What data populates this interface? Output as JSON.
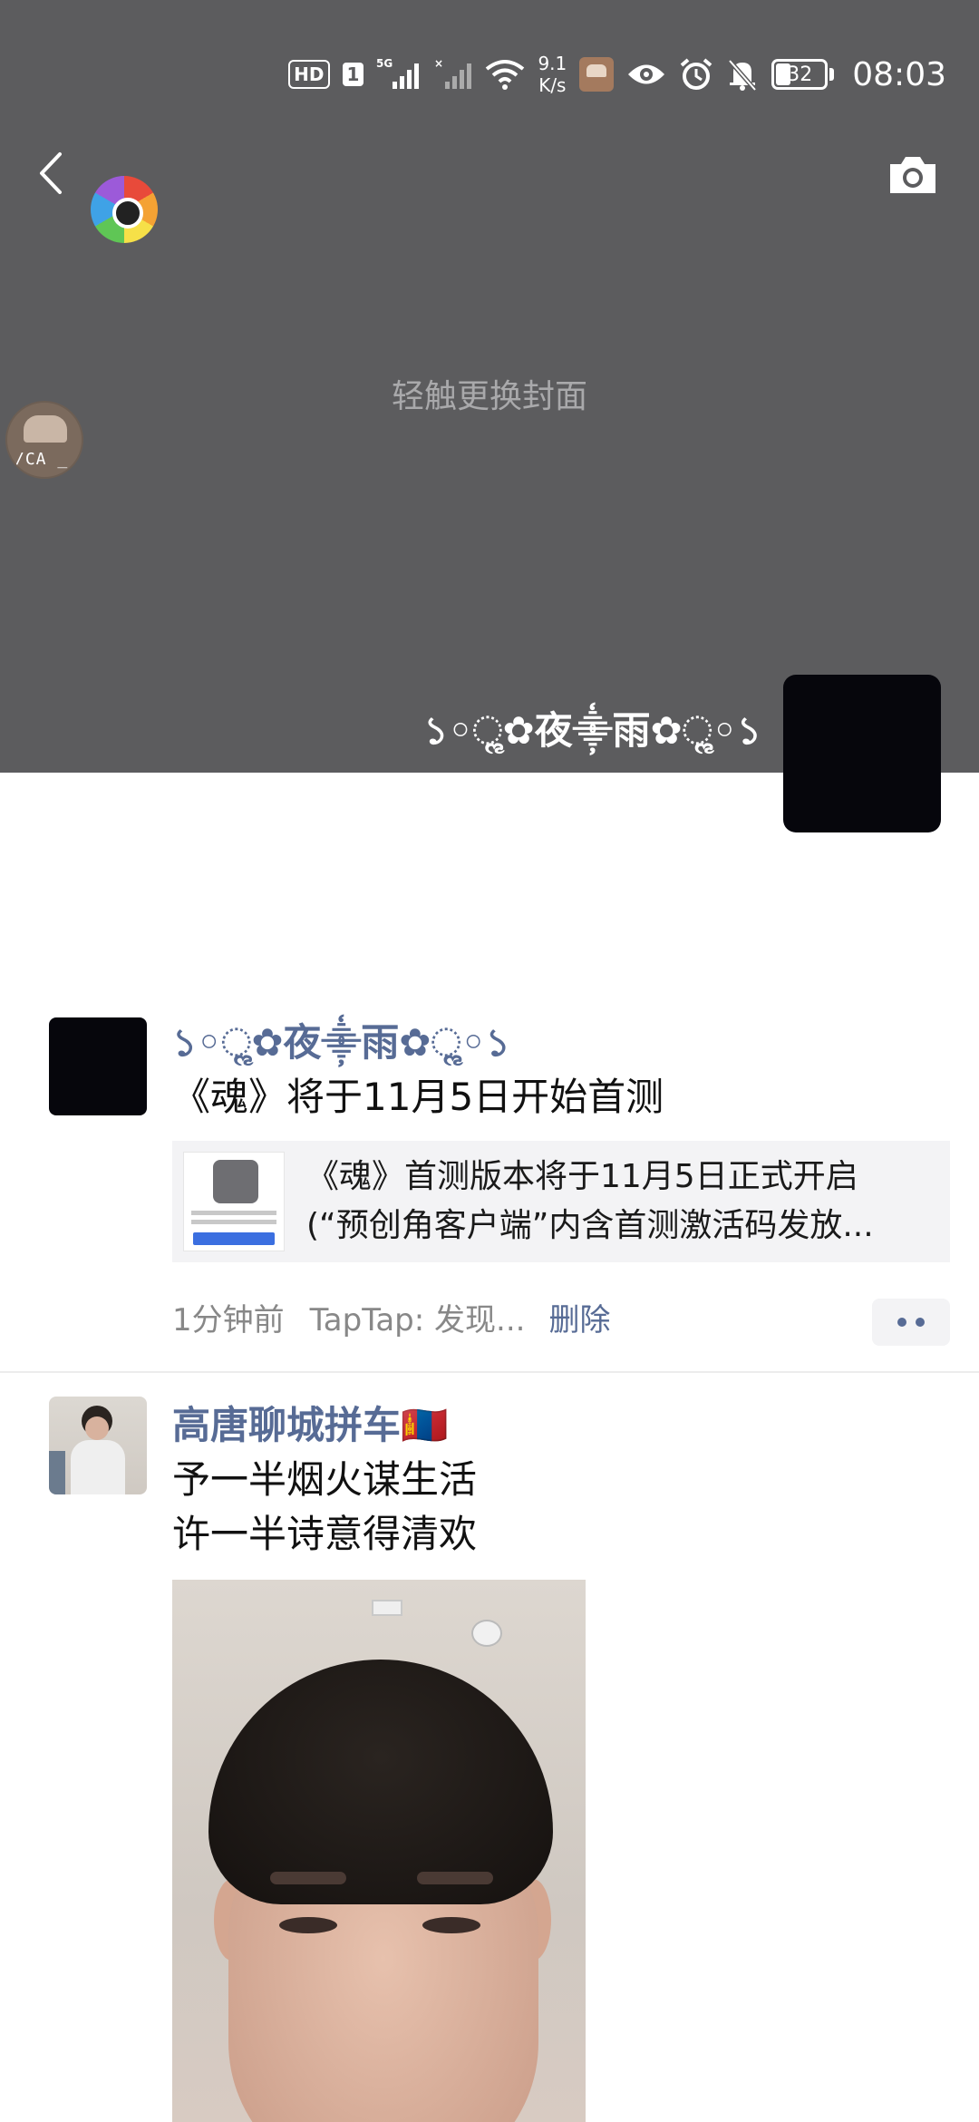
{
  "status_bar": {
    "hd": "HD",
    "sim": "1",
    "network": "5G",
    "speed_value": "9.1",
    "speed_unit": "K/s",
    "battery": "32",
    "time": "08:03"
  },
  "cover": {
    "hint": "轻触更换封面",
    "user_name": "১◦ૢ✿夜⸎雨✿ૢ◦১",
    "float_avatar_text": "/CA _"
  },
  "posts": [
    {
      "name": "১◦ૢ✿夜⸎雨✿ૢ◦১",
      "text": "《魂》将于11月5日开始首测",
      "link": {
        "line1": "《魂》首测版本将于11月5日正式开启",
        "line2": "(“预创角客户端”内含首测激活码发放..."
      },
      "time": "1分钟前",
      "source": "TapTap: 发现...",
      "delete": "删除"
    },
    {
      "name": "高唐聊城拼车",
      "flag": "🇲🇳",
      "text_lines": [
        "予一半烟火谋生活",
        "许一半诗意得清欢"
      ]
    }
  ],
  "colors": {
    "cover_bg": "#5c5c5e",
    "link_blue": "#576b95",
    "meta_grey": "#888888",
    "card_bg": "#f3f3f5"
  },
  "icons": [
    "back-arrow-icon",
    "aperture-icon",
    "camera-icon",
    "signal-icon",
    "wifi-icon",
    "eye-icon",
    "alarm-icon",
    "bell-off-icon",
    "battery-icon",
    "more-dots-icon"
  ]
}
